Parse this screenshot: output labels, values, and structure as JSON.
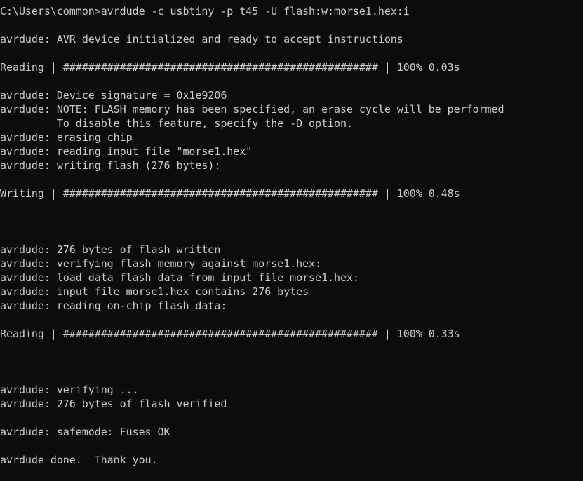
{
  "window": {
    "type": "command-prompt",
    "background_color": "#0c0c0c",
    "text_color": "#cccccc"
  },
  "console": {
    "lines": [
      "C:\\Users\\common>avrdude -c usbtiny -p t45 -U flash:w:morse1.hex:i",
      "",
      "avrdude: AVR device initialized and ready to accept instructions",
      "",
      "Reading | ################################################## | 100% 0.03s",
      "",
      "avrdude: Device signature = 0x1e9206",
      "avrdude: NOTE: FLASH memory has been specified, an erase cycle will be performed",
      "         To disable this feature, specify the -D option.",
      "avrdude: erasing chip",
      "avrdude: reading input file \"morse1.hex\"",
      "avrdude: writing flash (276 bytes):",
      "",
      "Writing | ################################################## | 100% 0.48s",
      "",
      "",
      "",
      "avrdude: 276 bytes of flash written",
      "avrdude: verifying flash memory against morse1.hex:",
      "avrdude: load data flash data from input file morse1.hex:",
      "avrdude: input file morse1.hex contains 276 bytes",
      "avrdude: reading on-chip flash data:",
      "",
      "Reading | ################################################## | 100% 0.33s",
      "",
      "",
      "",
      "avrdude: verifying ...",
      "avrdude: 276 bytes of flash verified",
      "",
      "avrdude: safemode: Fuses OK",
      "",
      "avrdude done.  Thank you.",
      ""
    ]
  },
  "progress": [
    {
      "label": "Reading",
      "percent": 100,
      "time": "0.03s"
    },
    {
      "label": "Writing",
      "percent": 100,
      "time": "0.48s"
    },
    {
      "label": "Reading",
      "percent": 100,
      "time": "0.33s"
    }
  ]
}
